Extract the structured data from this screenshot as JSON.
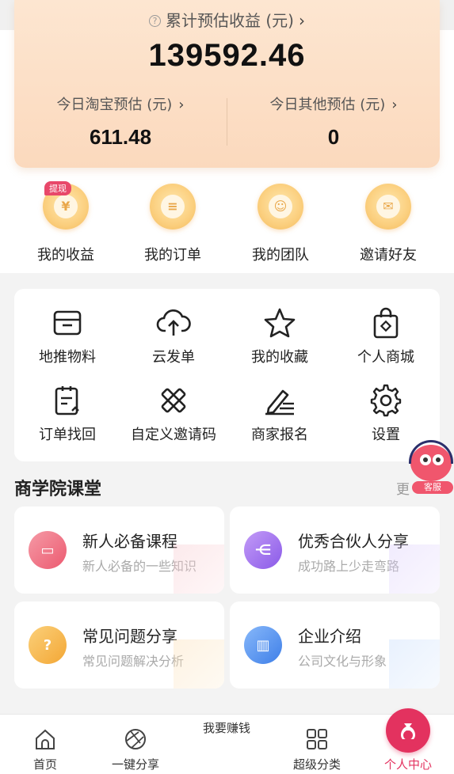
{
  "earnings": {
    "total_label": "累计预估收益 (元)",
    "total_value": "139592.46",
    "taobao_label": "今日淘宝预估 (元)",
    "taobao_value": "611.48",
    "other_label": "今日其他预估 (元)",
    "other_value": "0"
  },
  "quick_actions": [
    {
      "label": "我的收益",
      "icon": "yen-icon",
      "badge": "提现"
    },
    {
      "label": "我的订单",
      "icon": "order-icon"
    },
    {
      "label": "我的团队",
      "icon": "team-icon"
    },
    {
      "label": "邀请好友",
      "icon": "invite-icon"
    }
  ],
  "tools": [
    {
      "label": "地推物料",
      "icon": "box-icon"
    },
    {
      "label": "云发单",
      "icon": "cloud-upload-icon"
    },
    {
      "label": "我的收藏",
      "icon": "star-icon"
    },
    {
      "label": "个人商城",
      "icon": "shopping-bag-icon"
    },
    {
      "label": "订单找回",
      "icon": "clipboard-icon"
    },
    {
      "label": "自定义邀请码",
      "icon": "pencil-ruler-icon"
    },
    {
      "label": "商家报名",
      "icon": "signature-icon"
    },
    {
      "label": "设置",
      "icon": "gear-icon"
    }
  ],
  "academy": {
    "title": "商学院课堂",
    "more": "更",
    "courses": [
      {
        "title": "新人必备课程",
        "subtitle": "新人必备的一些知识",
        "color": "#ef6a7e"
      },
      {
        "title": "优秀合伙人分享",
        "subtitle": "成功路上少走弯路",
        "color": "#9a6df0"
      },
      {
        "title": "常见问题分享",
        "subtitle": "常见问题解决分析",
        "color": "#f6b448"
      },
      {
        "title": "企业介绍",
        "subtitle": "公司文化与形象",
        "color": "#4c8ef0"
      }
    ]
  },
  "support": {
    "label": "客服"
  },
  "tabbar": [
    {
      "label": "首页",
      "icon": "home-icon"
    },
    {
      "label": "一键分享",
      "icon": "aperture-icon"
    },
    {
      "label": "我要赚钱",
      "icon": "money-bag-icon"
    },
    {
      "label": "超级分类",
      "icon": "grid-icon"
    },
    {
      "label": "个人中心",
      "icon": "user-icon",
      "active": true
    }
  ],
  "colors": {
    "accent": "#e3325f",
    "card_gold": "#fbcf7e"
  }
}
